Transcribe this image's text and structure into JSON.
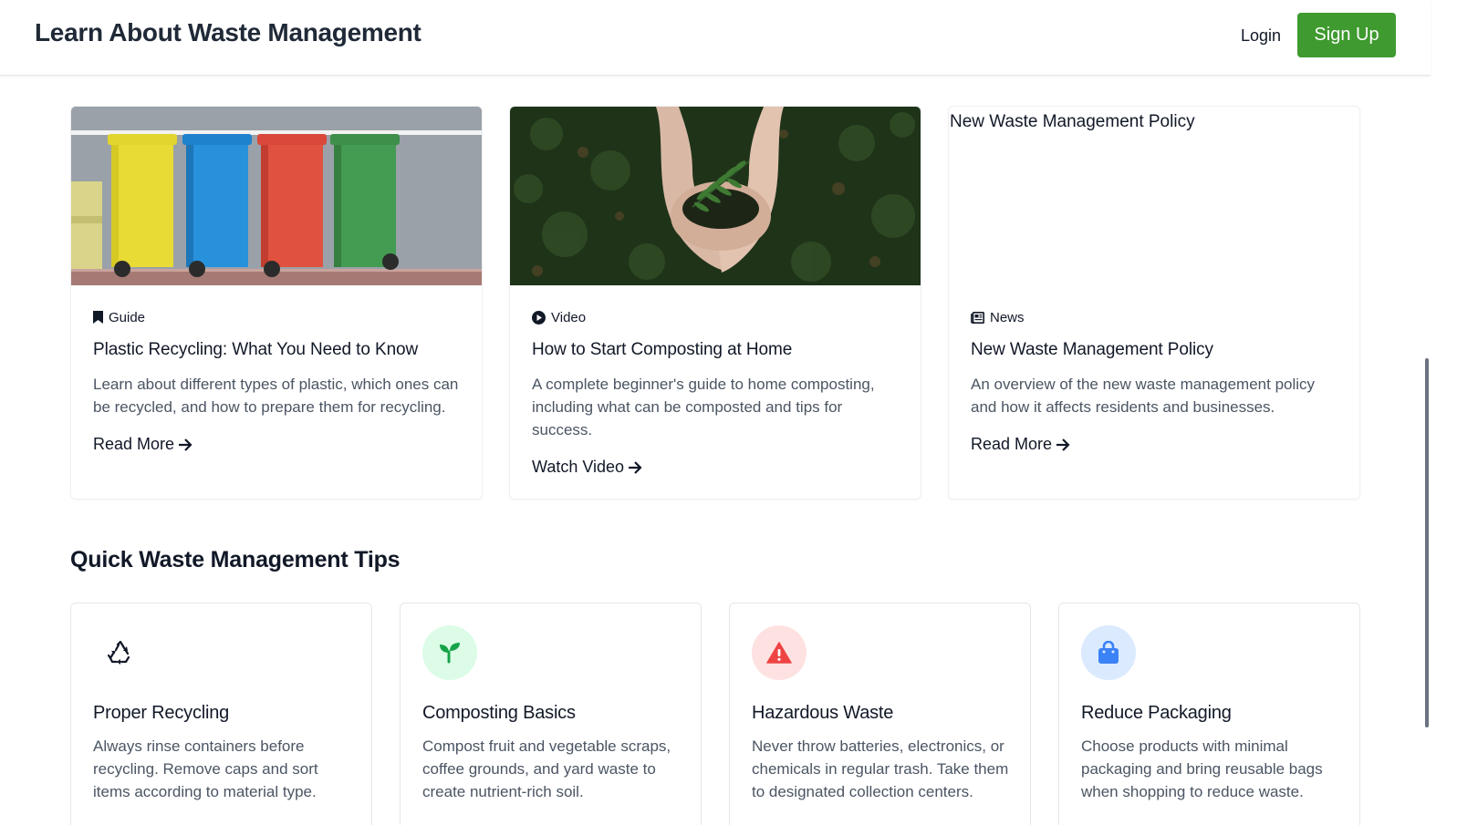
{
  "header": {
    "brand": "Learn About Waste Management",
    "login_label": "Login",
    "signup_label": "Sign Up",
    "signup_color": "#3f9a2f"
  },
  "cards": [
    {
      "image_icon": "recycling-bins-photo",
      "category": "Guide",
      "category_icon": "bookmark-icon",
      "title": "Plastic Recycling: What You Need to Know",
      "description": "Learn about different types of plastic, which ones can be recycled, and how to prepare them for recycling.",
      "link_label": "Read More"
    },
    {
      "image_icon": "hands-holding-plant-photo",
      "category": "Video",
      "category_icon": "play-circle-icon",
      "title": "How to Start Composting at Home",
      "description": "A complete beginner's guide to home composting, including what can be composted and tips for success.",
      "link_label": "Watch Video"
    },
    {
      "image_alt": "New Waste Management Policy",
      "category": "News",
      "category_icon": "newspaper-icon",
      "title": "New Waste Management Policy",
      "description": "An overview of the new waste management policy and how it affects residents and businesses.",
      "link_label": "Read More"
    }
  ],
  "tips_section": {
    "title": "Quick Waste Management Tips",
    "tips": [
      {
        "icon": "recycle-icon",
        "icon_bg": "#ffffff",
        "icon_color": "#111827",
        "title": "Proper Recycling",
        "description": "Always rinse containers before recycling. Remove caps and sort items according to material type."
      },
      {
        "icon": "seedling-icon",
        "icon_bg": "#dcfce7",
        "icon_color": "#16a34a",
        "title": "Composting Basics",
        "description": "Compost fruit and vegetable scraps, coffee grounds, and yard waste to create nutrient-rich soil."
      },
      {
        "icon": "warning-icon",
        "icon_bg": "#fee2e2",
        "icon_color": "#ef4444",
        "title": "Hazardous Waste",
        "description": "Never throw batteries, electronics, or chemicals in regular trash. Take them to designated collection centers."
      },
      {
        "icon": "shopping-bag-icon",
        "icon_bg": "#dbeafe",
        "icon_color": "#3b82f6",
        "title": "Reduce Packaging",
        "description": "Choose products with minimal packaging and bring reusable bags when shopping to reduce waste."
      }
    ]
  }
}
